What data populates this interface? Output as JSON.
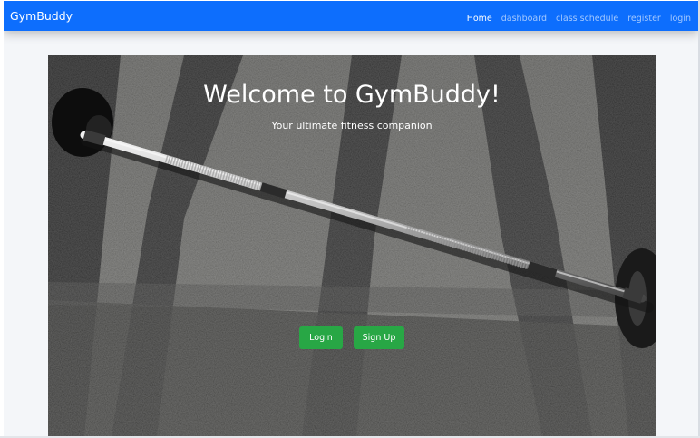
{
  "navbar": {
    "brand": "GymBuddy",
    "links": [
      {
        "label": "Home",
        "active": true
      },
      {
        "label": "dashboard",
        "active": false
      },
      {
        "label": "class schedule",
        "active": false
      },
      {
        "label": "register",
        "active": false
      },
      {
        "label": "login",
        "active": false
      }
    ]
  },
  "hero": {
    "title": "Welcome to GymBuddy!",
    "subtitle": "Your ultimate fitness companion",
    "buttons": {
      "login": "Login",
      "signup": "Sign Up"
    },
    "image_subject": "barbell-on-gym-floor"
  },
  "colors": {
    "navbar": "#0d6efd",
    "button": "#28a745",
    "page_background": "#f4f6f9"
  }
}
